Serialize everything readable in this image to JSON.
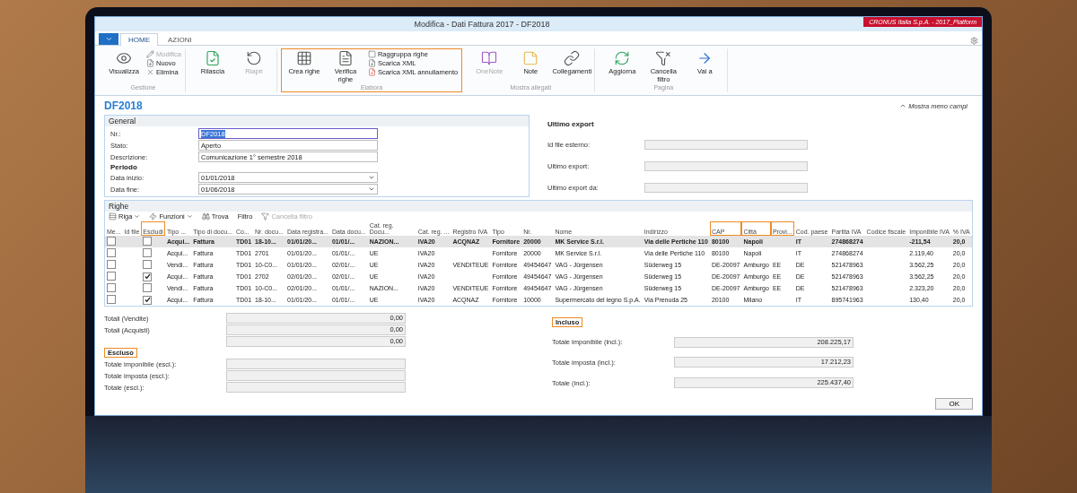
{
  "window": {
    "title": "Modifica - Dati Fattura 2017 - DF2018",
    "company": "CRONUS Italia S.p.A. - 2017_Platform"
  },
  "tabs": [
    {
      "label": "HOME",
      "selected": true
    },
    {
      "label": "AZIONI",
      "selected": false
    }
  ],
  "ribbon": [
    {
      "label": "Gestione",
      "highlighted": false,
      "buttons": [
        {
          "label": "Visualizza",
          "kind": "large",
          "disabled": false
        },
        {
          "label": "Modifica",
          "kind": "small",
          "disabled": true
        },
        {
          "label": "Nuovo",
          "kind": "small",
          "disabled": false
        },
        {
          "label": "Elimina",
          "kind": "small",
          "disabled": false
        }
      ]
    },
    {
      "highlighted": false,
      "buttons": [
        {
          "label": "Rilascia",
          "kind": "large",
          "disabled": false
        },
        {
          "label": "Riapri",
          "kind": "large",
          "disabled": true
        }
      ]
    },
    {
      "label": "Elabora",
      "highlighted": true,
      "buttons": [
        {
          "label": "Crea righe",
          "kind": "large",
          "disabled": false
        },
        {
          "label": "Verifica righe",
          "kind": "large",
          "disabled": false
        },
        {
          "label": "Raggruppa righe",
          "kind": "small",
          "disabled": false
        },
        {
          "label": "Scarica XML",
          "kind": "small",
          "disabled": false
        },
        {
          "label": "Scarica XML annullamento",
          "kind": "small",
          "disabled": false
        }
      ]
    },
    {
      "label": "Mostra allegati",
      "highlighted": false,
      "buttons": [
        {
          "label": "OneNote",
          "kind": "large",
          "disabled": true
        },
        {
          "label": "Note",
          "kind": "large",
          "disabled": false
        },
        {
          "label": "Collegamenti",
          "kind": "large",
          "disabled": false
        }
      ]
    },
    {
      "label": "Pagina",
      "highlighted": false,
      "buttons": [
        {
          "label": "Aggiorna",
          "kind": "large",
          "disabled": false
        },
        {
          "label": "Cancella filtro",
          "kind": "large",
          "disabled": false
        },
        {
          "label": "Vai a",
          "kind": "large",
          "disabled": false
        }
      ]
    }
  ],
  "show_less": "Mostra meno campi",
  "page_title": "DF2018",
  "general": {
    "title": "General",
    "fields": [
      {
        "label": "Nr.:",
        "value": "DF2018",
        "kind": "text",
        "focused": true
      },
      {
        "label": "Stato:",
        "value": "Aperto",
        "kind": "text",
        "focused": false
      },
      {
        "label": "Descrizione:",
        "value": "Comunicazione 1° semestre 2018",
        "kind": "text",
        "focused": false
      },
      {
        "label": "Periodo",
        "kind": "heading"
      },
      {
        "label": "Data inizio:",
        "value": "01/01/2018",
        "kind": "dropdown",
        "focused": false
      },
      {
        "label": "Data fine:",
        "value": "01/06/2018",
        "kind": "dropdown",
        "focused": false
      }
    ]
  },
  "export": {
    "title": "Ultimo export",
    "fields": [
      {
        "label": "Id file esterno:"
      },
      {
        "label": "Ultimo export:"
      },
      {
        "label": "Ultimo export da:"
      }
    ]
  },
  "lines": {
    "title": "Righe",
    "toolbar": [
      {
        "label": "Riga",
        "menu": true,
        "disabled": false
      },
      {
        "label": "Funzioni",
        "menu": true,
        "disabled": false
      },
      {
        "label": "Trova",
        "menu": false,
        "disabled": false
      },
      {
        "label": "Filtro",
        "menu": false,
        "disabled": false
      },
      {
        "label": "Cancella filtro",
        "menu": false,
        "disabled": true
      }
    ],
    "columns": [
      {
        "label": "Me...",
        "highlighted": false
      },
      {
        "label": "Id file",
        "highlighted": false
      },
      {
        "label": "Escludi",
        "highlighted": true
      },
      {
        "label": "Tipo ...",
        "highlighted": false
      },
      {
        "label": "Tipo di docu...",
        "highlighted": false
      },
      {
        "label": "Co...",
        "highlighted": false
      },
      {
        "label": "Nr. docu...",
        "highlighted": false
      },
      {
        "label": "Data registra...",
        "highlighted": false
      },
      {
        "label": "Data docu...",
        "highlighted": false
      },
      {
        "label": "Cat. reg. Docu...",
        "highlighted": false
      },
      {
        "label": "Cat. reg. ...",
        "highlighted": false
      },
      {
        "label": "Registro IVA",
        "highlighted": false
      },
      {
        "label": "Tipo",
        "highlighted": false
      },
      {
        "label": "Nr.",
        "highlighted": false
      },
      {
        "label": "Nome",
        "highlighted": false
      },
      {
        "label": "Indirizzo",
        "highlighted": false
      },
      {
        "label": "CAP",
        "highlighted": true
      },
      {
        "label": "Città",
        "highlighted": true
      },
      {
        "label": "Provi...",
        "highlighted": true
      },
      {
        "label": "Cod. paese",
        "highlighted": false
      },
      {
        "label": "Partita IVA",
        "highlighted": false
      },
      {
        "label": "Codice fiscale",
        "highlighted": false
      },
      {
        "label": "Imponibile IVA",
        "highlighted": false
      },
      {
        "label": "% IVA",
        "highlighted": false
      }
    ],
    "rows": [
      {
        "marked": false,
        "excluded": false,
        "selected": true,
        "cells": [
          "",
          "",
          "",
          "Acqui...",
          "Fattura",
          "TD01",
          "18-10...",
          "01/01/20...",
          "01/01/...",
          "NAZION...",
          "IVA20",
          "ACQNAZ",
          "Fornitore",
          "20000",
          "MK Service S.r.l.",
          "Via delle Pertiche 110",
          "80100",
          "Napoli",
          "",
          "IT",
          "274868274",
          "",
          "-211,54",
          "20,0"
        ]
      },
      {
        "marked": false,
        "excluded": false,
        "selected": false,
        "cells": [
          "",
          "",
          "",
          "Acqui...",
          "Fattura",
          "TD01",
          "2701",
          "01/01/20...",
          "01/01/...",
          "UE",
          "IVA20",
          "",
          "Fornitore",
          "20000",
          "MK Service S.r.l.",
          "Via delle Pertiche 110",
          "80100",
          "Napoli",
          "",
          "IT",
          "274868274",
          "",
          "2.119,40",
          "20,0"
        ]
      },
      {
        "marked": false,
        "excluded": false,
        "selected": false,
        "cells": [
          "",
          "",
          "",
          "Vendi...",
          "Fattura",
          "TD01",
          "10-C0...",
          "01/01/20...",
          "02/01/...",
          "UE",
          "IVA20",
          "VENDITEUE",
          "Fornitore",
          "49454647",
          "VAG - Jürgensen",
          "Süderweg 15",
          "DE-20097",
          "Amburgo",
          "EE",
          "DE",
          "521478963",
          "",
          "3.562,25",
          "20,0"
        ]
      },
      {
        "marked": false,
        "excluded": true,
        "selected": false,
        "cells": [
          "",
          "",
          "",
          "Acqui...",
          "Fattura",
          "TD01",
          "2702",
          "02/01/20...",
          "02/01/...",
          "UE",
          "IVA20",
          "",
          "Fornitore",
          "49454647",
          "VAG - Jürgensen",
          "Süderweg 15",
          "DE-20097",
          "Amburgo",
          "EE",
          "DE",
          "521478963",
          "",
          "3.562,25",
          "20,0"
        ]
      },
      {
        "marked": false,
        "excluded": false,
        "selected": false,
        "cells": [
          "",
          "",
          "",
          "Vendi...",
          "Fattura",
          "TD01",
          "10-C0...",
          "02/01/20...",
          "01/01/...",
          "NAZION...",
          "IVA20",
          "VENDITEUE",
          "Fornitore",
          "49454647",
          "VAG - Jürgensen",
          "Süderweg 15",
          "DE-20097",
          "Amburgo",
          "EE",
          "DE",
          "521478963",
          "",
          "2.323,20",
          "20,0"
        ]
      },
      {
        "marked": false,
        "excluded": true,
        "selected": false,
        "cells": [
          "",
          "",
          "",
          "Acqui...",
          "Fattura",
          "TD01",
          "18-10...",
          "01/01/20...",
          "01/01/...",
          "UE",
          "IVA20",
          "ACQNAZ",
          "Fornitore",
          "10000",
          "Supermercato del legno S.p.A.",
          "Via Prenuda 25",
          "20100",
          "Milano",
          "",
          "IT",
          "895741963",
          "",
          "130,40",
          "20,0"
        ]
      }
    ]
  },
  "totals": {
    "left": [
      {
        "label": "Totali (Vendite)",
        "value": "0,00"
      },
      {
        "label": "Totali (Acquisti)",
        "value": "0,00"
      },
      {
        "value": "0,00"
      }
    ],
    "excluded": {
      "title": "Escluso",
      "fields": [
        {
          "label": "Totale imponibile (escl.):"
        },
        {
          "label": "Totale imposta (escl.):"
        },
        {
          "label": "Totale (escl.):"
        }
      ]
    },
    "included": {
      "title": "Incluso",
      "fields": [
        {
          "label": "Totale imponibile (incl.):",
          "value": "208.225,17"
        },
        {
          "label": "Totale imposta (incl.):",
          "value": "17.212,23"
        },
        {
          "label": "Totale (incl.):",
          "value": "225.437,40"
        }
      ]
    }
  },
  "ok_button": "OK"
}
